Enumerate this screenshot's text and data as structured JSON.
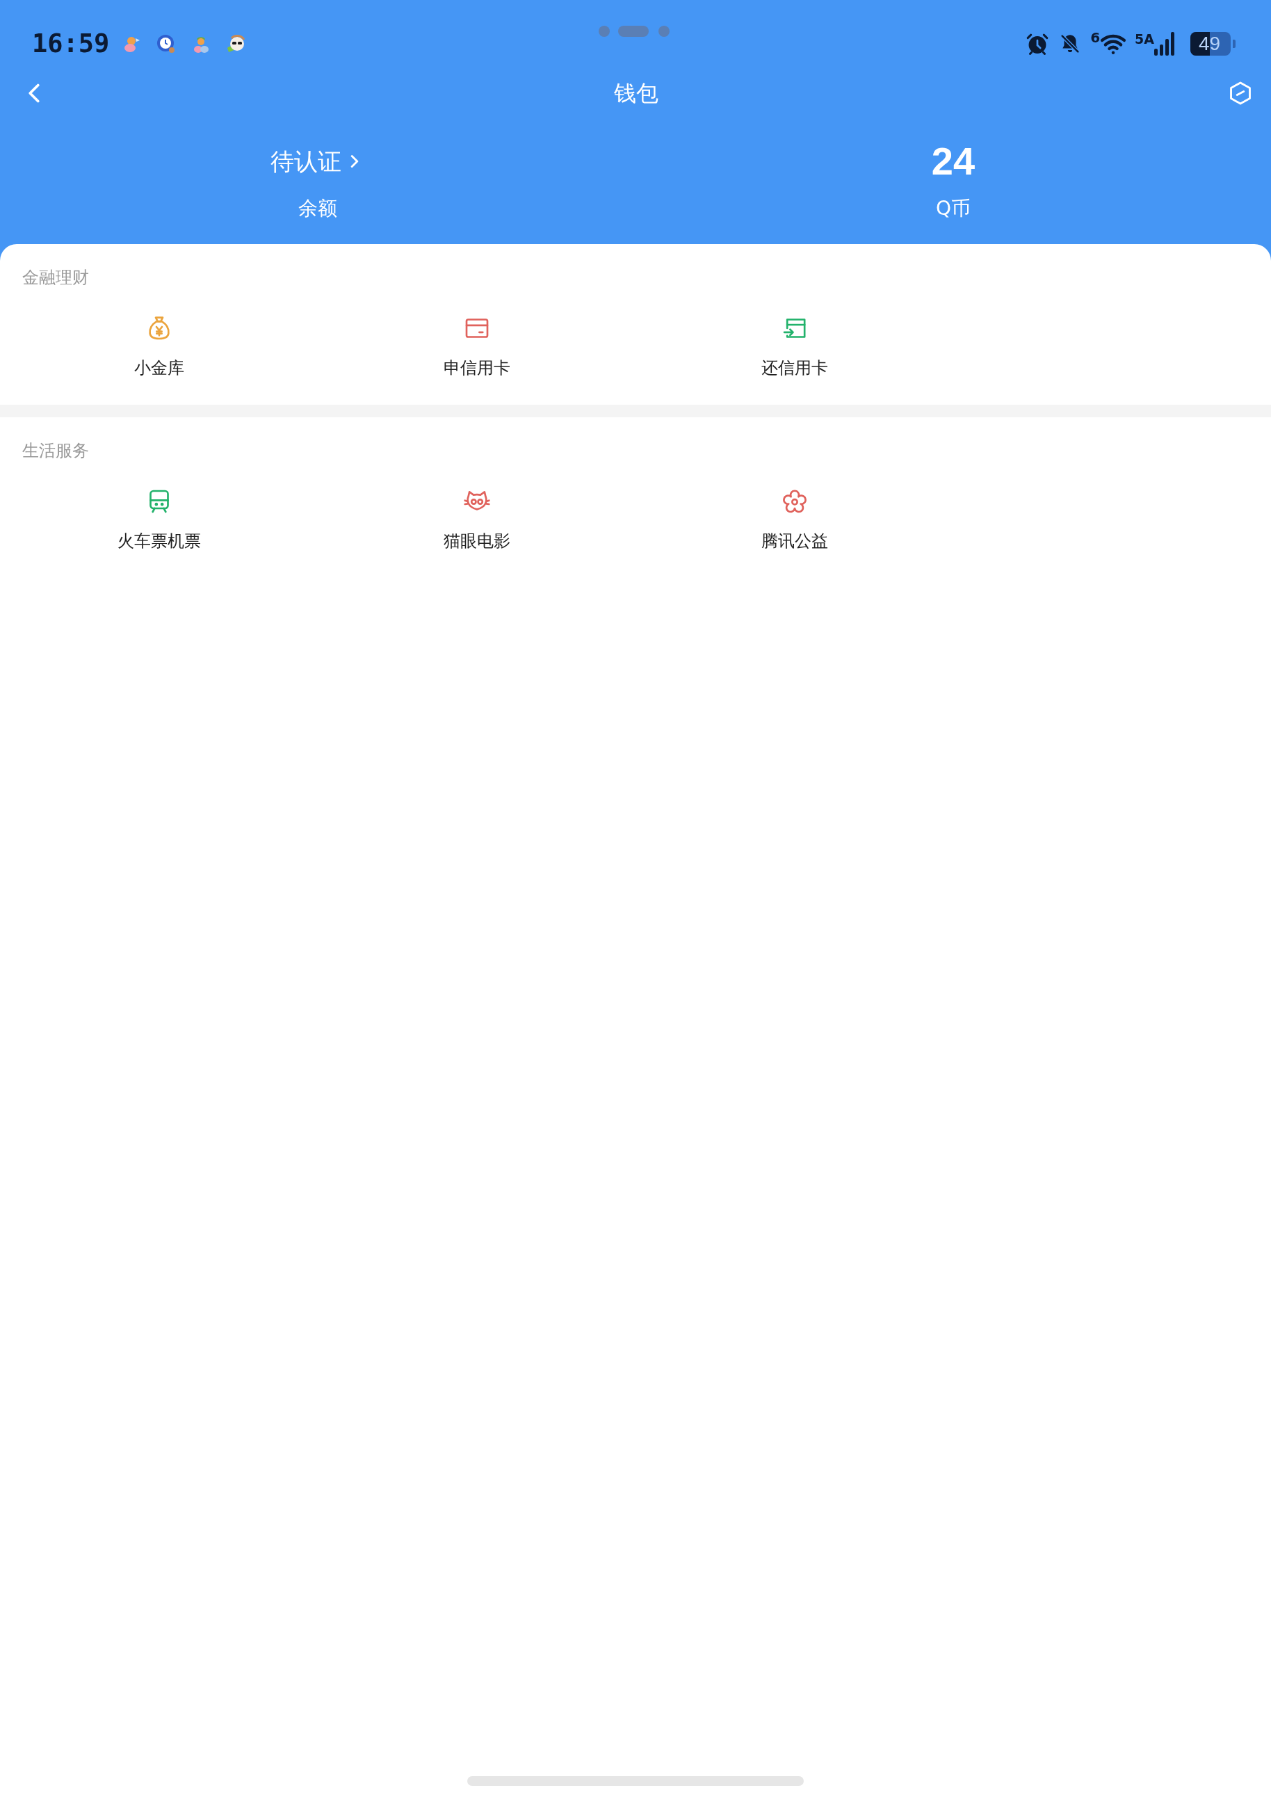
{
  "status_bar": {
    "time": "16:59",
    "wifi_label": "6",
    "network_label": "5A",
    "battery": "49"
  },
  "nav": {
    "title": "钱包"
  },
  "summary": [
    {
      "kind": "link",
      "value": "待认证",
      "label": "余额"
    },
    {
      "kind": "amount",
      "value": "24",
      "label": "Q币"
    }
  ],
  "sections": [
    {
      "title": "金融理财",
      "items": [
        {
          "kind": "moneybag",
          "label": "小金库"
        },
        {
          "kind": "card",
          "label": "申信用卡"
        },
        {
          "kind": "repay",
          "label": "还信用卡"
        }
      ]
    },
    {
      "title": "生活服务",
      "items": [
        {
          "kind": "train",
          "label": "火车票机票"
        },
        {
          "kind": "cat",
          "label": "猫眼电影"
        },
        {
          "kind": "flower",
          "label": "腾讯公益"
        }
      ]
    }
  ]
}
